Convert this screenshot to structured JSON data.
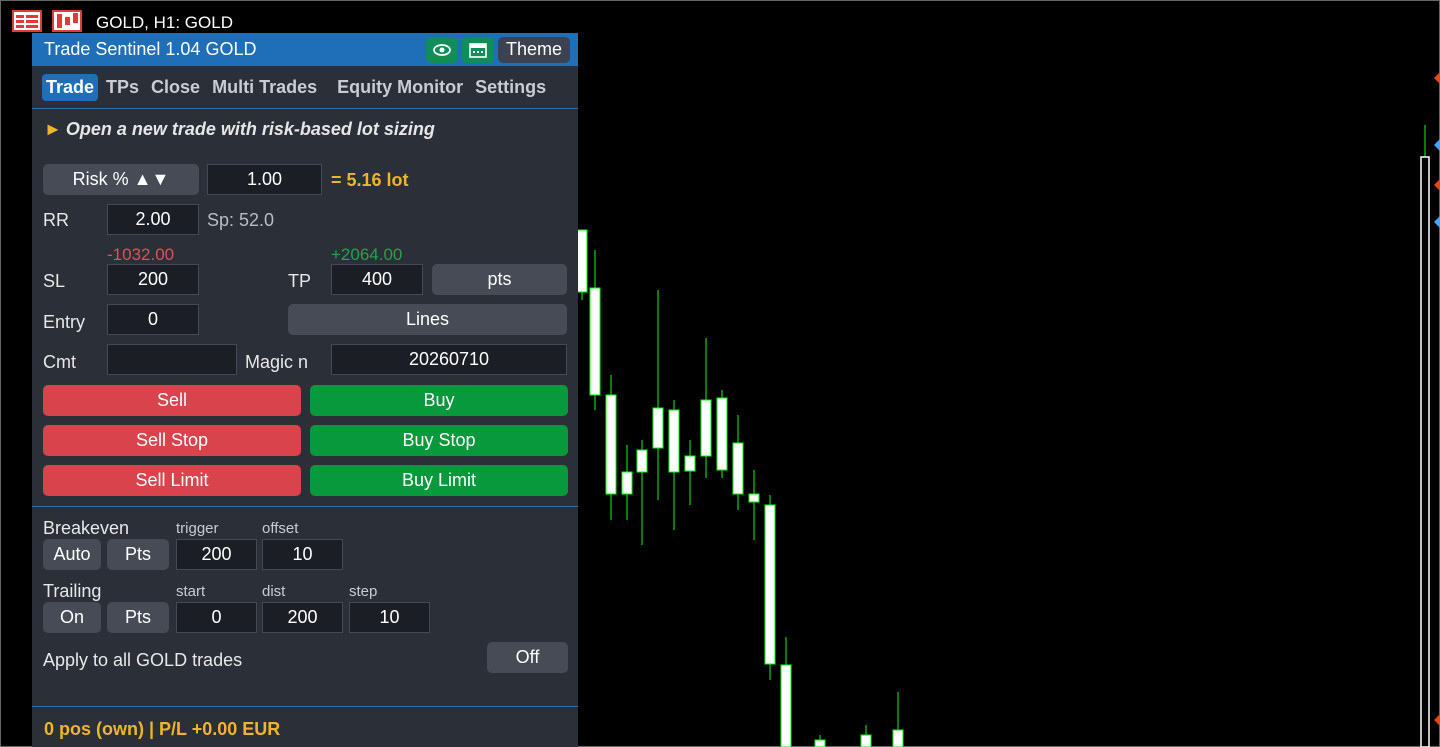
{
  "chart": {
    "symbol_label": "GOLD, H1:  GOLD",
    "colors": {
      "bull_body": "#ffffff",
      "wick": "#00ff00",
      "background": "#000000"
    },
    "icons": [
      "menu-icon",
      "chart-icon"
    ]
  },
  "panel": {
    "title": "Trade Sentinel 1.04  GOLD",
    "theme_label": "Theme",
    "icons": [
      "eye-icon",
      "calendar-icon"
    ],
    "tabs": [
      {
        "label": "Trade"
      },
      {
        "label": "TPs"
      },
      {
        "label": "Close"
      },
      {
        "label": "Multi Trades"
      },
      {
        "label": "Equity Monitor"
      },
      {
        "label": "Settings"
      }
    ],
    "hint": "Open a new trade with risk-based lot sizing",
    "risk": {
      "mode_label": "Risk % ▲▼",
      "value": "1.00",
      "lot": "= 5.16 lot"
    },
    "rr": {
      "label": "RR",
      "value": "2.00",
      "spread": "Sp: 52.0"
    },
    "sl": {
      "label": "SL",
      "value": "200",
      "money": "-1032.00"
    },
    "tp": {
      "label": "TP",
      "value": "400",
      "money": "+2064.00",
      "unit_label": "pts"
    },
    "entry": {
      "label": "Entry",
      "value": "0",
      "lines_label": "Lines"
    },
    "comment": {
      "label": "Cmt",
      "value": ""
    },
    "magic": {
      "label": "Magic n",
      "value": "20260710"
    },
    "orders": {
      "sell": "Sell",
      "buy": "Buy",
      "sell_stop": "Sell Stop",
      "buy_stop": "Buy Stop",
      "sell_limit": "Sell Limit",
      "buy_limit": "Buy Limit"
    },
    "breakeven": {
      "label": "Breakeven",
      "auto_label": "Auto",
      "pts_label": "Pts",
      "trigger_label": "trigger",
      "trigger_value": "200",
      "offset_label": "offset",
      "offset_value": "10"
    },
    "trailing": {
      "label": "Trailing",
      "on_label": "On",
      "pts_label": "Pts",
      "start_label": "start",
      "start_value": "0",
      "dist_label": "dist",
      "dist_value": "200",
      "step_label": "step",
      "step_value": "10"
    },
    "apply_all": {
      "label": "Apply to all GOLD trades",
      "toggle_label": "Off"
    },
    "status": "0 pos (own)  |  P/L +0.00 EUR",
    "colors": {
      "title_bar": "#1f6fb8",
      "panel_bg": "#2b2f37",
      "sell": "#d9434b",
      "buy": "#07993b",
      "accent": "#f0b429",
      "loss_text": "#e0505a",
      "profit_text": "#1fa64a"
    }
  }
}
